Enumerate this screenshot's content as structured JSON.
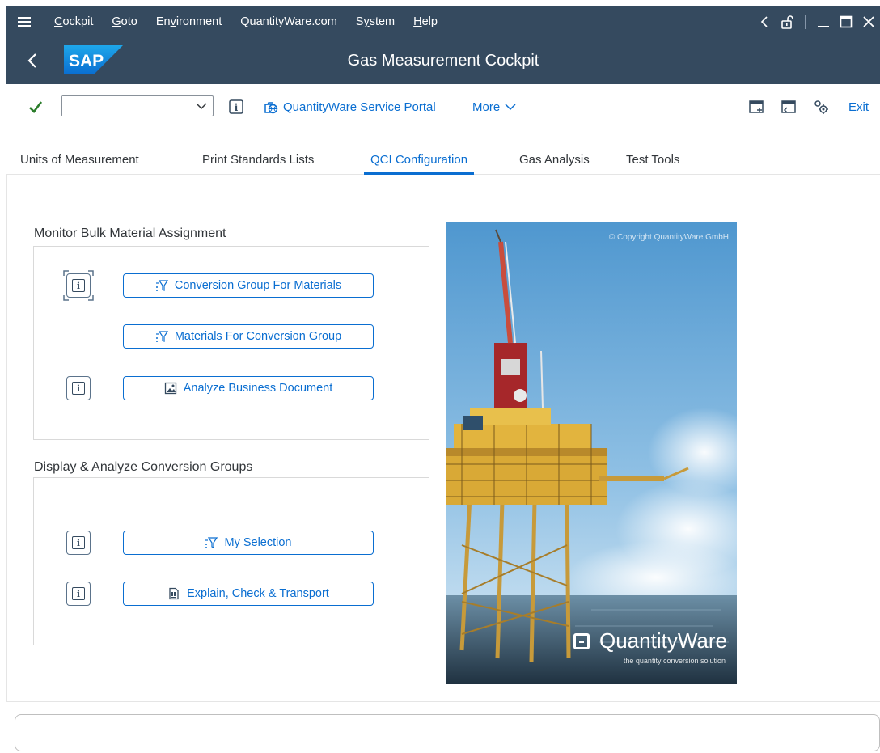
{
  "menubar": {
    "items": [
      "Cockpit",
      "Goto",
      "Environment",
      "QuantityWare.com",
      "System",
      "Help"
    ],
    "underline": [
      "C",
      "G",
      "v",
      "",
      "y",
      "H"
    ]
  },
  "shell": {
    "title": "Gas Measurement Cockpit",
    "logo": "SAP"
  },
  "toolbar": {
    "command_value": "",
    "portal_label": "QuantityWare Service Portal",
    "more_label": "More",
    "exit_label": "Exit"
  },
  "tabs": [
    {
      "label": "Units of Measurement",
      "active": false
    },
    {
      "label": "Print Standards Lists",
      "active": false
    },
    {
      "label": "QCI Configuration",
      "active": true
    },
    {
      "label": "Gas Analysis",
      "active": false
    },
    {
      "label": "Test Tools",
      "active": false
    }
  ],
  "groups": {
    "monitor": {
      "title": "Monitor Bulk Material Assignment",
      "buttons": [
        "Conversion Group For Materials",
        "Materials For Conversion Group",
        "Analyze Business Document"
      ]
    },
    "display": {
      "title": "Display & Analyze Conversion Groups",
      "buttons": [
        "My Selection",
        "Explain, Check & Transport"
      ]
    }
  },
  "image": {
    "copyright": "© Copyright QuantityWare GmbH",
    "brand": "QuantityWare",
    "tagline": "the quantity conversion solution"
  },
  "colors": {
    "shell": "#354a5f",
    "accent": "#0a6ed1",
    "success": "#2b7d2b"
  }
}
